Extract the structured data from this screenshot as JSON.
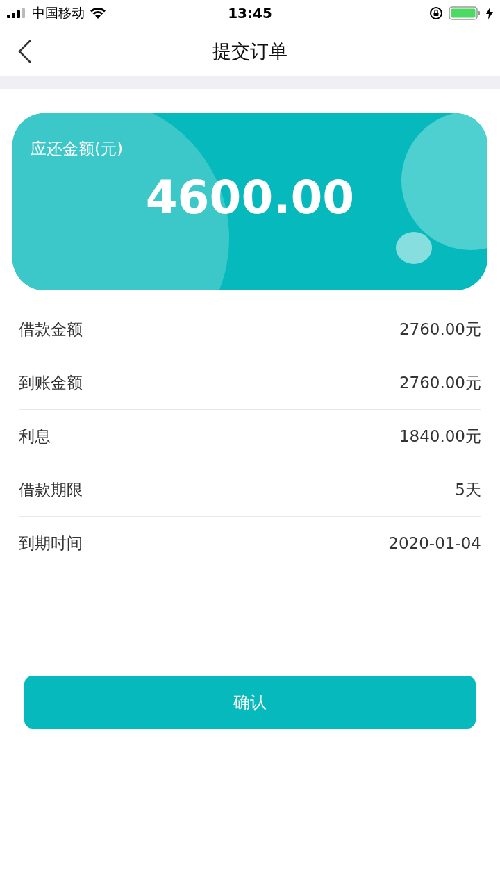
{
  "status_bar": {
    "carrier": "中国移动",
    "time": "13:45"
  },
  "nav": {
    "title": "提交订单"
  },
  "amount_card": {
    "label": "应还金额(元)",
    "amount": "4600.00"
  },
  "details": [
    {
      "label": "借款金额",
      "value": "2760.00元"
    },
    {
      "label": "到账金额",
      "value": "2760.00元"
    },
    {
      "label": "利息",
      "value": "1840.00元"
    },
    {
      "label": "借款期限",
      "value": "5天"
    },
    {
      "label": "到期时间",
      "value": "2020-01-04"
    }
  ],
  "confirm_button": "确认"
}
